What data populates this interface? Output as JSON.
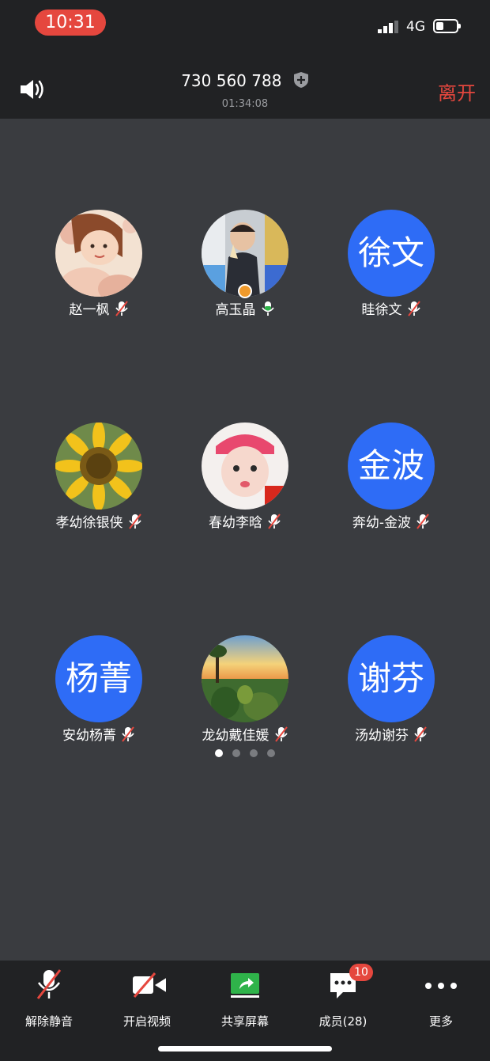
{
  "status_bar": {
    "time": "10:31",
    "network": "4G"
  },
  "meeting": {
    "id": "730 560 788",
    "duration": "01:34:08",
    "leave_label": "离开"
  },
  "participants": [
    {
      "name": "赵一枫",
      "avatar": "photo-girl-illustration",
      "mic": "muted"
    },
    {
      "name": "高玉晶",
      "avatar": "photo-child",
      "mic": "on",
      "host": true
    },
    {
      "name": "眭徐文",
      "avatar_text": "徐文",
      "mic": "muted"
    },
    {
      "name": "孝幼徐银侠",
      "avatar": "photo-sunflower",
      "mic": "muted"
    },
    {
      "name": "春幼李晗",
      "avatar": "photo-baby",
      "mic": "muted"
    },
    {
      "name": "奔幼-金波",
      "avatar_text": "金波",
      "mic": "muted"
    },
    {
      "name": "安幼杨菁",
      "avatar_text": "杨菁",
      "mic": "muted"
    },
    {
      "name": "龙幼戴佳媛",
      "avatar": "photo-landscape",
      "mic": "muted"
    },
    {
      "name": "汤幼谢芬",
      "avatar_text": "谢芬",
      "mic": "muted"
    }
  ],
  "pagination": {
    "pages": 4,
    "current": 1
  },
  "toolbar": {
    "unmute_label": "解除静音",
    "video_label": "开启视频",
    "share_label": "共享屏幕",
    "members_label": "成员(28)",
    "members_badge": "10",
    "more_label": "更多"
  },
  "colors": {
    "accent_blue": "#2e6cf6",
    "leave_red": "#e5473e",
    "share_green": "#2fb34a"
  }
}
